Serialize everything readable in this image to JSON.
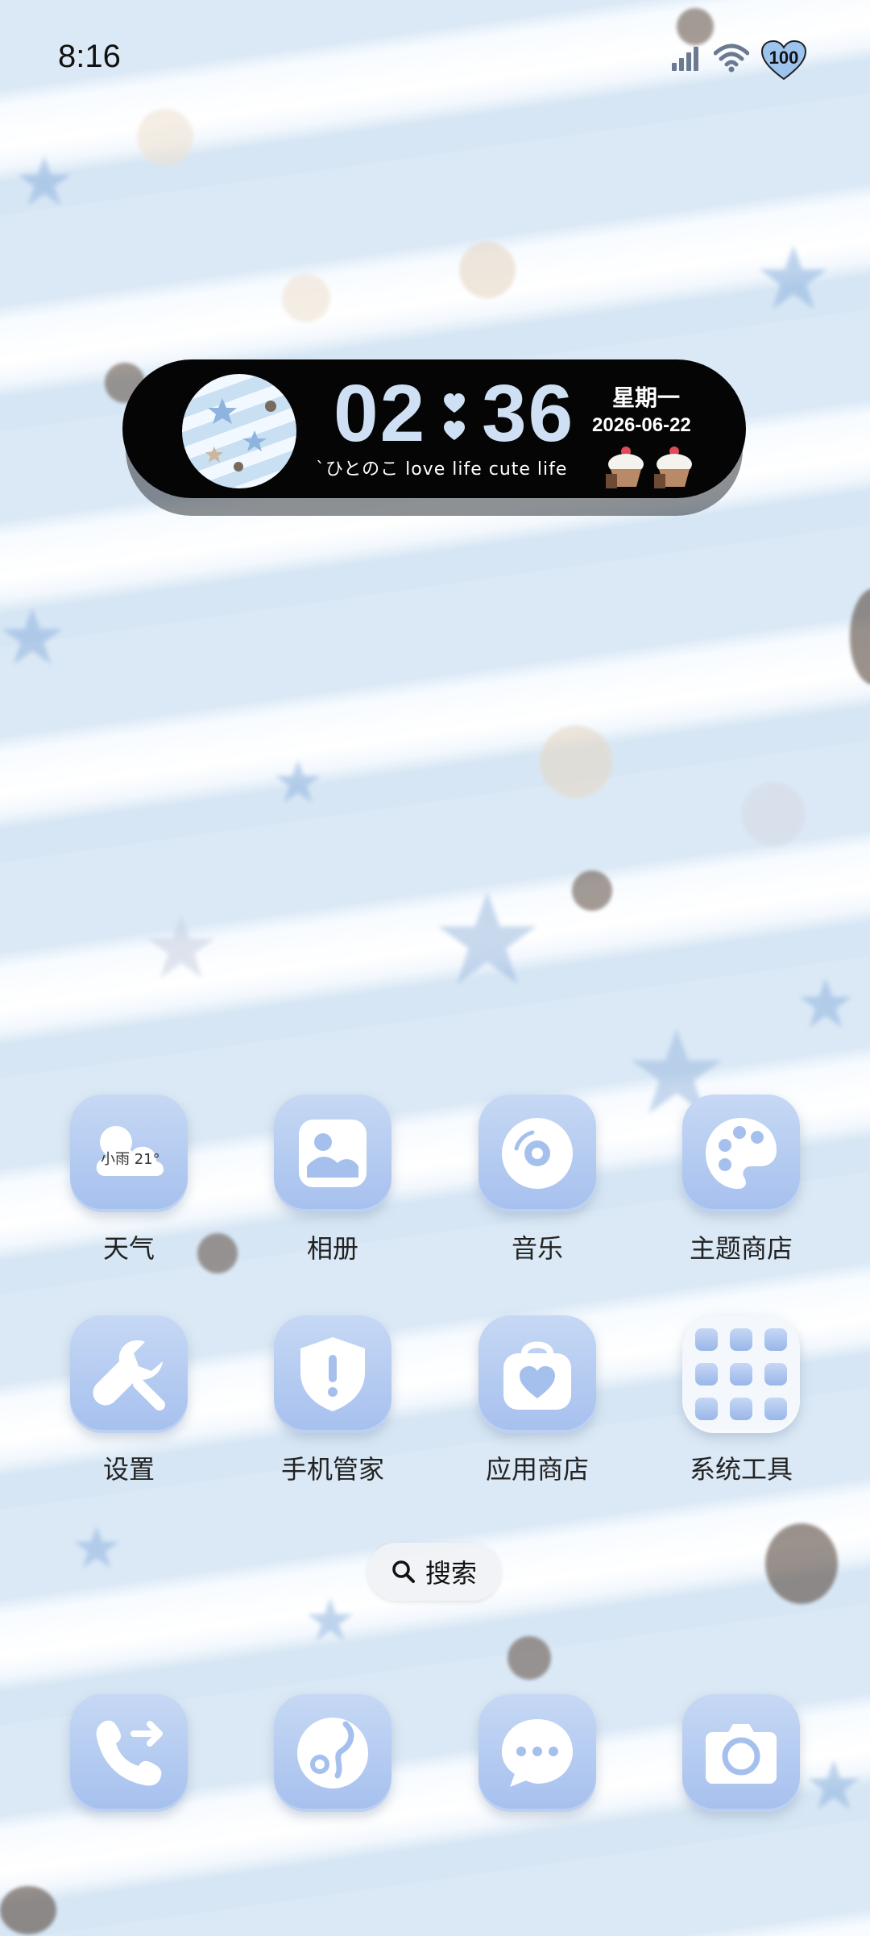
{
  "status_bar": {
    "time": "8:16",
    "battery": "100",
    "icons": [
      "signal-icon",
      "wifi-icon",
      "battery-heart-icon"
    ]
  },
  "clock_widget": {
    "hours": "02",
    "minutes": "36",
    "weekday": "星期一",
    "date": "2026-06-22",
    "tagline": "`ひとのこ love life cute life",
    "accent": "#cfe0f5"
  },
  "apps": [
    {
      "label": "天气",
      "icon": "weather-cloud-icon",
      "badge": "小雨 21°"
    },
    {
      "label": "相册",
      "icon": "gallery-icon"
    },
    {
      "label": "音乐",
      "icon": "music-disc-icon"
    },
    {
      "label": "主题商店",
      "icon": "palette-icon"
    },
    {
      "label": "设置",
      "icon": "wrench-icon"
    },
    {
      "label": "手机管家",
      "icon": "shield-icon"
    },
    {
      "label": "应用商店",
      "icon": "store-bag-icon"
    },
    {
      "label": "系统工具",
      "icon": "folder-icon"
    }
  ],
  "search": {
    "label": "搜索"
  },
  "dock": [
    {
      "icon": "phone-icon"
    },
    {
      "icon": "browser-icon"
    },
    {
      "icon": "messages-icon"
    },
    {
      "icon": "camera-icon"
    }
  ],
  "colors": {
    "icon_gradient_top": "#c6d8f4",
    "icon_gradient_bottom": "#a6c0ee",
    "widget_bg": "#050505"
  }
}
